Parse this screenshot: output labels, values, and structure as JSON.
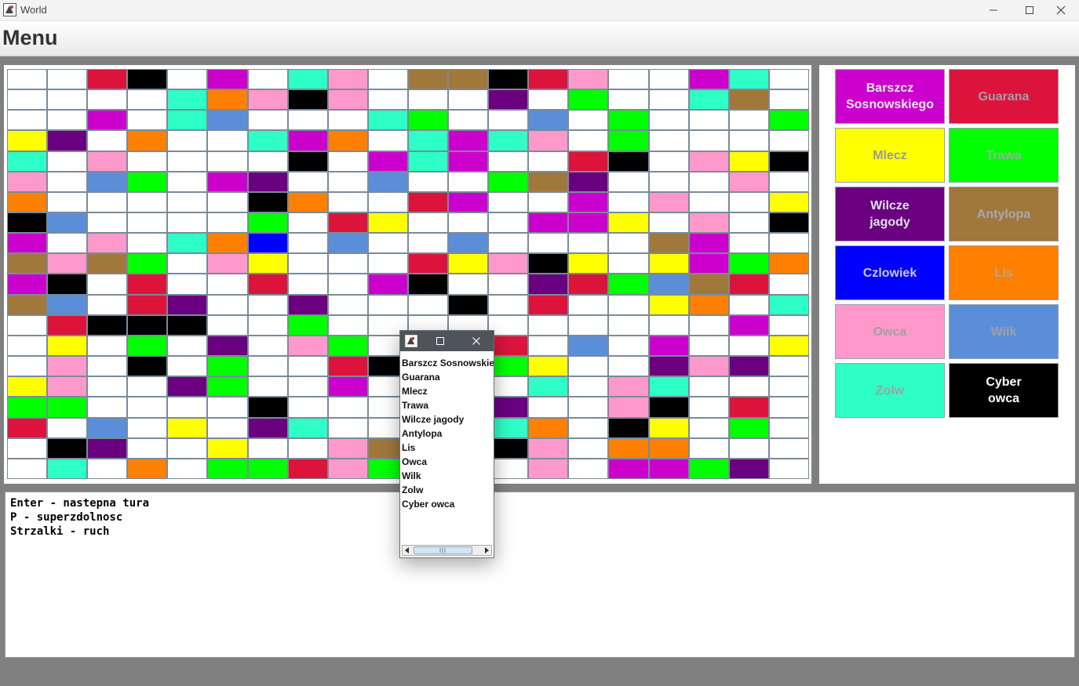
{
  "window": {
    "title": "World"
  },
  "menu": {
    "label": "Menu"
  },
  "palette": {
    "W": "#ffffff",
    "BS": "#cc00cc",
    "GU": "#dc143c",
    "ML": "#ffff00",
    "TR": "#00ff00",
    "WJ": "#6a0080",
    "AN": "#a0783c",
    "CZ": "#0000ff",
    "LI": "#ff8000",
    "OW": "#ff99cc",
    "WI": "#5b8ed8",
    "ZO": "#2dffc6",
    "CO": "#000000"
  },
  "board": {
    "rows": [
      "W W GU CO W BS W ZO OW W AN AN CO GU OW W W BS ZO W",
      "W W W W ZO LI OW CO OW W W W WJ W TR W W ZO AN W",
      "W W BS W ZO WI W W W ZO TR W W WI W TR W W W TR",
      "ML WJ W LI W W ZO BS LI W ZO BS ZO OW W TR W W W W",
      "ZO W OW W W W W CO W BS ZO BS W W GU CO W OW ML CO",
      "OW W WI TR W BS WJ W W WI W W TR AN WJ W W W OW W",
      "LI W W W W W CO LI W W GU BS W W BS W OW W W ML",
      "CO WI W W W W TR W GU ML W W W BS BS ML W OW W CO",
      "BS W OW W ZO LI CZ W WI W W WI W W W W AN BS W W",
      "AN OW AN TR W OW ML W W W GU ML OW CO ML W ML BS TR LI",
      "BS CO W GU W W GU W W BS CO W W WJ GU TR WI AN GU W",
      "AN WI W GU WJ W W WJ W W W CO W GU W W ML LI W ZO",
      "W GU CO CO CO W W TR W W W W W W W W W W BS W",
      "W ML W TR W WJ W OW TR W W W GU W WI W BS W W ML",
      "W OW W CO W TR W W GU CO W W TR ML W W WJ OW WJ W",
      "ML OW W W WJ TR W W BS W W W W ZO W OW ZO W W W",
      "TR TR W W W W CO W W W W W WJ W W OW CO W GU W",
      "GU W WI W ML W WJ ZO W W W W ZO LI W CO ML W TR W",
      "W CO WJ W W ML W W OW AN W W CO OW W LI LI W W W",
      "W ZO W LI W TR TR GU OW TR W W W OW W BS BS TR WJ W"
    ]
  },
  "legend": [
    {
      "label": "Barszcz\nSosnowskiego",
      "bg": "#cc00cc",
      "fg": "#e8e8f0"
    },
    {
      "label": "Guarana",
      "bg": "#dc143c",
      "fg": "#a0a0a8"
    },
    {
      "label": "Mlecz",
      "bg": "#ffff00",
      "fg": "#9a9a9a"
    },
    {
      "label": "Trawa",
      "bg": "#00ff00",
      "fg": "#9ab09a"
    },
    {
      "label": "Wilcze\njagody",
      "bg": "#6a0080",
      "fg": "#e0e0e8"
    },
    {
      "label": "Antylopa",
      "bg": "#a0783c",
      "fg": "#a8a8b0"
    },
    {
      "label": "Czlowiek",
      "bg": "#0000ff",
      "fg": "#c8c8d8"
    },
    {
      "label": "Lis",
      "bg": "#ff8000",
      "fg": "#a8a8a8"
    },
    {
      "label": "Owca",
      "bg": "#ff99cc",
      "fg": "#a0a0a0"
    },
    {
      "label": "Wilk",
      "bg": "#5b8ed8",
      "fg": "#a0a0a8"
    },
    {
      "label": "Zolw",
      "bg": "#2dffc6",
      "fg": "#a0a0a0"
    },
    {
      "label": "Cyber\nowca",
      "bg": "#000000",
      "fg": "#ffffff"
    }
  ],
  "console": {
    "lines": [
      "Enter - nastepna tura",
      "P - superzdolnosc",
      "Strzalki - ruch"
    ]
  },
  "popup": {
    "items": [
      "Barszcz Sosnowskiego",
      "Guarana",
      "Mlecz",
      "Trawa",
      "Wilcze jagody",
      "Antylopa",
      "Lis",
      "Owca",
      "Wilk",
      "Zolw",
      "Cyber owca"
    ]
  }
}
